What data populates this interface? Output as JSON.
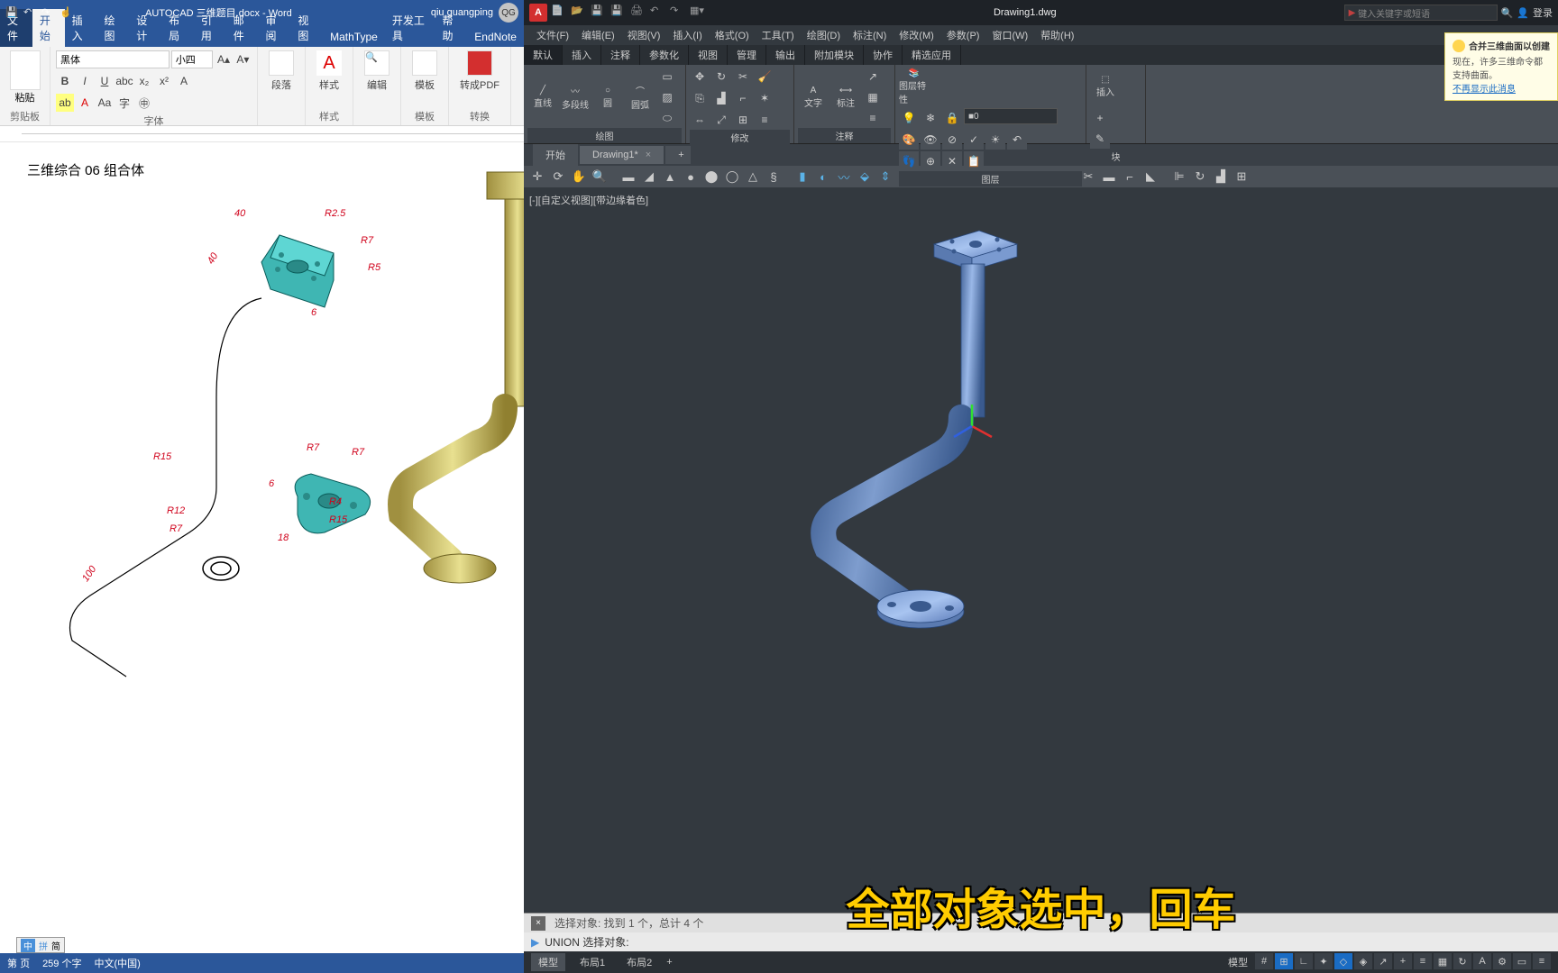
{
  "word": {
    "qat_icons": [
      "save",
      "undo",
      "redo",
      "touch",
      "sync"
    ],
    "doc_title": "AUTOCAD 三维题目.docx - Word",
    "user_name": "qiu guangping",
    "user_initials": "QG",
    "tabs": [
      "文件",
      "开始",
      "插入",
      "绘图",
      "设计",
      "布局",
      "引用",
      "邮件",
      "审阅",
      "视图",
      "MathType",
      "开发工具",
      "帮助",
      "EndNote"
    ],
    "active_tab": 1,
    "ribbon": {
      "clipboard": "剪贴板",
      "paste": "粘贴",
      "font_group": "字体",
      "font_name": "黑体",
      "font_size": "小四",
      "para": "段落",
      "styles": "样式",
      "edit": "编辑",
      "template": "模板",
      "pdf": "转成PDF",
      "pdf2": "转换"
    },
    "doc_heading": "三维综合 06 组合体",
    "dims": {
      "d40a": "40",
      "d40b": "40",
      "r25": "R2.5",
      "r7a": "R7",
      "r5": "R5",
      "d6": "6",
      "r15a": "R15",
      "r7b": "R7",
      "r7c": "R7",
      "d6b": "6",
      "r4": "R4",
      "r15b": "R15",
      "d18": "18",
      "r12": "R12",
      "r7d": "R7",
      "d100": "100"
    },
    "status": {
      "page": "页",
      "words": "259 个字",
      "lang": "中文(中国)"
    },
    "ime": [
      "中",
      "拼",
      "简"
    ]
  },
  "autocad": {
    "qat": [
      "new",
      "open",
      "save",
      "saveas",
      "plot",
      "undo",
      "redo",
      "workspace"
    ],
    "file_name": "Drawing1.dwg",
    "search_placeholder": "键入关键字或短语",
    "login": "登录",
    "menus": [
      "文件(F)",
      "编辑(E)",
      "视图(V)",
      "插入(I)",
      "格式(O)",
      "工具(T)",
      "绘图(D)",
      "标注(N)",
      "修改(M)",
      "参数(P)",
      "窗口(W)",
      "帮助(H)"
    ],
    "ribbon_tabs": [
      "默认",
      "插入",
      "注释",
      "参数化",
      "视图",
      "管理",
      "输出",
      "附加模块",
      "协作",
      "精选应用"
    ],
    "ribbon_groups": {
      "draw": "绘图",
      "modify": "修改",
      "annot": "注释",
      "layers": "图层",
      "block": "块"
    },
    "draw_labels": {
      "line": "直线",
      "pline": "多段线",
      "circle": "圆",
      "arc": "圆弧"
    },
    "annot_labels": {
      "text": "文字",
      "dim": "标注"
    },
    "layer_labels": {
      "props": "图层特性"
    },
    "block_labels": {
      "insert": "插入"
    },
    "layer_sel": "0",
    "doc_tabs": [
      "开始",
      "Drawing1*"
    ],
    "view_label": "[-][自定义视图][带边缘着色]",
    "cmd_history": "选择对象: 找到 1 个，总计 4 个",
    "cmd_current": "UNION 选择对象:",
    "status_tabs": [
      "模型",
      "布局1",
      "布局2"
    ],
    "model_label": "模型",
    "notif": {
      "title": "合并三维曲面以创建",
      "body": "现在，许多三维命令都支持曲面。",
      "link": "不再显示此消息"
    }
  },
  "subtitle": "全部对象选中，回车"
}
